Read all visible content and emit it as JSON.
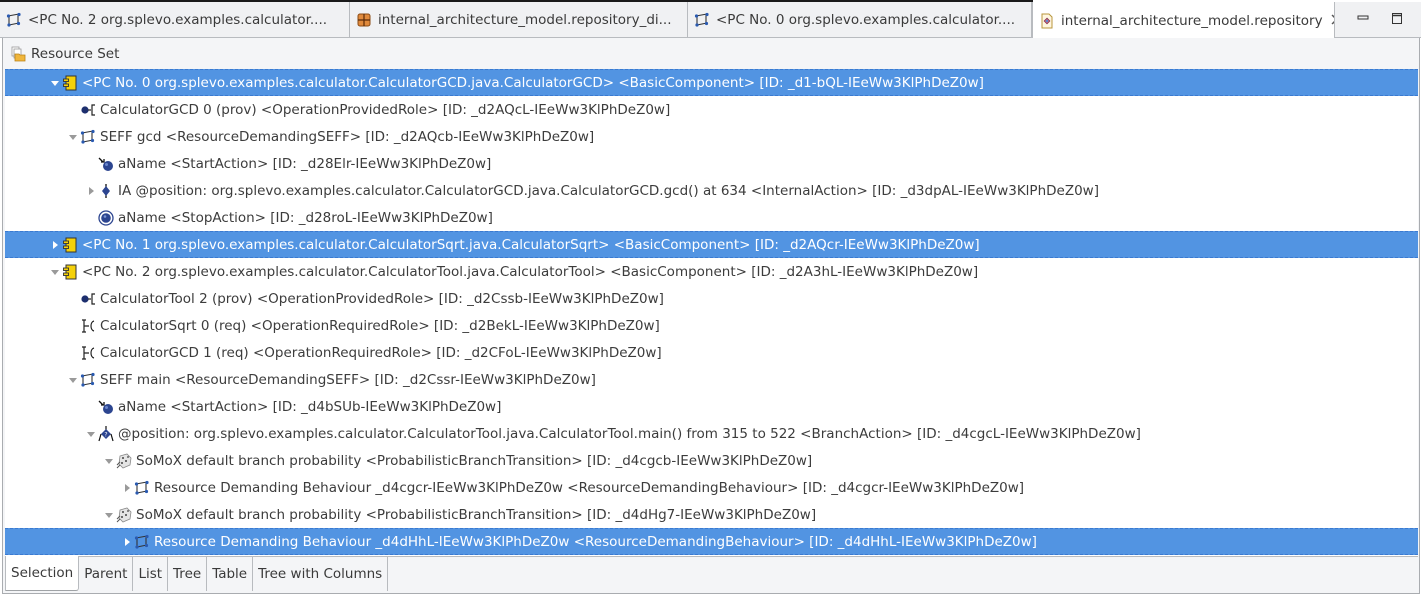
{
  "editor_tabs": [
    {
      "label": "<PC No. 2 org.splevo.examples.calculator....",
      "icon": "seff-icon",
      "active": false
    },
    {
      "label": "internal_architecture_model.repository_di...",
      "icon": "diagram-icon",
      "active": false
    },
    {
      "label": "<PC No. 0 org.splevo.examples.calculator....",
      "icon": "seff-icon",
      "active": false
    },
    {
      "label": "internal_architecture_model.repository",
      "icon": "repository-file-icon",
      "active": true,
      "close": "✕"
    }
  ],
  "window_controls": {
    "minimize": "minimize-icon",
    "maximize": "maximize-icon"
  },
  "resource_set": {
    "label": "Resource Set",
    "icon": "resource-set-icon"
  },
  "tree": [
    {
      "depth": 0,
      "twisty": "expanded",
      "icon": "component-icon",
      "selected": true,
      "label": "<PC No. 0 org.splevo.examples.calculator.CalculatorGCD.java.CalculatorGCD> <BasicComponent>  [ID: _d1-bQL-IEeWw3KlPhDeZ0w]"
    },
    {
      "depth": 1,
      "twisty": "none",
      "icon": "provided-role-icon",
      "selected": false,
      "label": "CalculatorGCD 0 (prov) <OperationProvidedRole>  [ID: _d2AQcL-IEeWw3KlPhDeZ0w]"
    },
    {
      "depth": 1,
      "twisty": "expanded",
      "icon": "seff-icon",
      "selected": false,
      "label": "SEFF gcd <ResourceDemandingSEFF>  [ID: _d2AQcb-IEeWw3KlPhDeZ0w]"
    },
    {
      "depth": 2,
      "twisty": "none",
      "icon": "start-action-icon",
      "selected": false,
      "label": "aName <StartAction>  [ID: _d28Elr-IEeWw3KlPhDeZ0w]"
    },
    {
      "depth": 2,
      "twisty": "collapsed",
      "icon": "internal-action-icon",
      "selected": false,
      "label": "IA  @position: org.splevo.examples.calculator.CalculatorGCD.java.CalculatorGCD.gcd() at 634 <InternalAction>  [ID: _d3dpAL-IEeWw3KlPhDeZ0w]"
    },
    {
      "depth": 2,
      "twisty": "none",
      "icon": "stop-action-icon",
      "selected": false,
      "label": "aName <StopAction>  [ID: _d28roL-IEeWw3KlPhDeZ0w]"
    },
    {
      "depth": 0,
      "twisty": "collapsed",
      "icon": "component-icon",
      "selected": true,
      "label": "<PC No. 1 org.splevo.examples.calculator.CalculatorSqrt.java.CalculatorSqrt> <BasicComponent>  [ID: _d2AQcr-IEeWw3KlPhDeZ0w]"
    },
    {
      "depth": 0,
      "twisty": "expanded",
      "icon": "component-icon",
      "selected": false,
      "label": "<PC No. 2 org.splevo.examples.calculator.CalculatorTool.java.CalculatorTool> <BasicComponent>  [ID: _d2A3hL-IEeWw3KlPhDeZ0w]"
    },
    {
      "depth": 1,
      "twisty": "none",
      "icon": "provided-role-icon",
      "selected": false,
      "label": "CalculatorTool 2 (prov) <OperationProvidedRole>  [ID: _d2Cssb-IEeWw3KlPhDeZ0w]"
    },
    {
      "depth": 1,
      "twisty": "none",
      "icon": "required-role-icon",
      "selected": false,
      "label": "CalculatorSqrt 0 (req) <OperationRequiredRole>  [ID: _d2BekL-IEeWw3KlPhDeZ0w]"
    },
    {
      "depth": 1,
      "twisty": "none",
      "icon": "required-role-icon",
      "selected": false,
      "label": "CalculatorGCD 1 (req) <OperationRequiredRole>  [ID: _d2CFoL-IEeWw3KlPhDeZ0w]"
    },
    {
      "depth": 1,
      "twisty": "expanded",
      "icon": "seff-icon",
      "selected": false,
      "label": "SEFF main <ResourceDemandingSEFF>  [ID: _d2Cssr-IEeWw3KlPhDeZ0w]"
    },
    {
      "depth": 2,
      "twisty": "none",
      "icon": "start-action-icon",
      "selected": false,
      "label": "aName <StartAction>  [ID: _d4bSUb-IEeWw3KlPhDeZ0w]"
    },
    {
      "depth": 2,
      "twisty": "expanded",
      "icon": "branch-action-icon",
      "selected": false,
      "label": "@position: org.splevo.examples.calculator.CalculatorTool.java.CalculatorTool.main() from 315 to 522 <BranchAction>  [ID: _d4cgcL-IEeWw3KlPhDeZ0w]"
    },
    {
      "depth": 3,
      "twisty": "expanded",
      "icon": "probabilistic-branch-icon",
      "selected": false,
      "label": "SoMoX default branch probability <ProbabilisticBranchTransition>  [ID: _d4cgcb-IEeWw3KlPhDeZ0w]"
    },
    {
      "depth": 4,
      "twisty": "collapsed",
      "icon": "seff-icon",
      "selected": false,
      "label": "Resource Demanding Behaviour _d4cgcr-IEeWw3KlPhDeZ0w <ResourceDemandingBehaviour>  [ID: _d4cgcr-IEeWw3KlPhDeZ0w]"
    },
    {
      "depth": 3,
      "twisty": "expanded",
      "icon": "probabilistic-branch-icon",
      "selected": false,
      "label": "SoMoX default branch probability <ProbabilisticBranchTransition>  [ID: _d4dHg7-IEeWw3KlPhDeZ0w]"
    },
    {
      "depth": 4,
      "twisty": "collapsed",
      "icon": "seff-icon",
      "selected": true,
      "label": "Resource Demanding Behaviour _d4dHhL-IEeWw3KlPhDeZ0w <ResourceDemandingBehaviour>  [ID: _d4dHhL-IEeWw3KlPhDeZ0w]"
    }
  ],
  "bottom_tabs": [
    {
      "label": "Selection",
      "active": true
    },
    {
      "label": "Parent",
      "active": false
    },
    {
      "label": "List",
      "active": false
    },
    {
      "label": "Tree",
      "active": false
    },
    {
      "label": "Table",
      "active": false
    },
    {
      "label": "Tree with Columns",
      "active": false
    }
  ],
  "colors": {
    "selection": "#5294e2",
    "tab_bg": "#f0f1f3",
    "panel_bg": "#f4f5f7"
  }
}
